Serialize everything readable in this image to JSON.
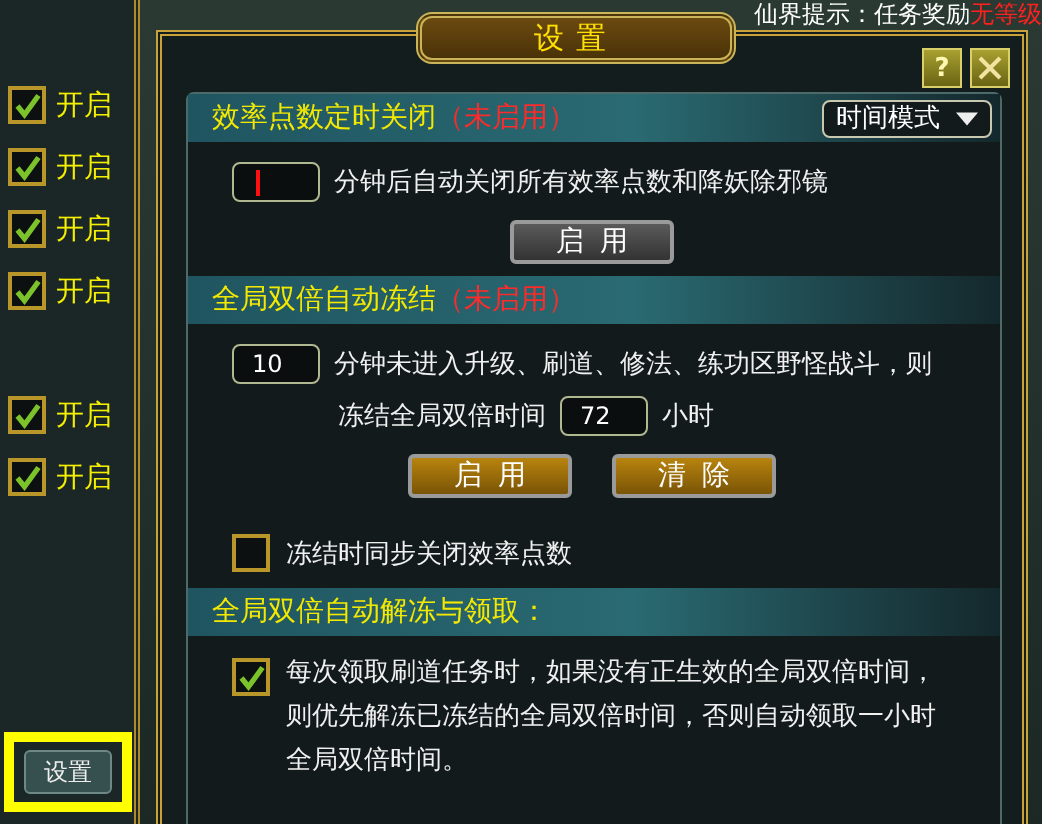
{
  "background": {
    "notice": {
      "label": "仙界提示：任务奖励",
      "highlight": "无等级"
    }
  },
  "sidebar": {
    "toggles": [
      {
        "label": "开启",
        "checked": true
      },
      {
        "label": "开启",
        "checked": true
      },
      {
        "label": "开启",
        "checked": true
      },
      {
        "label": "开启",
        "checked": true
      },
      {
        "label": "开启",
        "checked": true
      },
      {
        "label": "开启",
        "checked": true
      }
    ],
    "settings_button": "设置"
  },
  "dialog": {
    "title": "设置",
    "help": "?",
    "sections": [
      {
        "kind": "timer",
        "title": "效率点数定时关闭",
        "status": "（未启用）",
        "mode_dropdown": "时间模式",
        "minutes": {
          "focused": true
        },
        "description": "分钟后自动关闭所有效率点数和降妖除邪镜",
        "buttons": [
          {
            "label": "启用",
            "disabled": true
          }
        ]
      },
      {
        "kind": "freeze",
        "title": "全局双倍自动冻结",
        "status": "（未启用）",
        "minutes": {
          "value": "10",
          "focused": false
        },
        "text_before": "分钟未进入升级、刷道、修法、练功区野怪战斗，则",
        "text_hours": "冻结全局双倍时间",
        "hours": "72",
        "unit": "小时",
        "buttons": [
          {
            "label": "启用",
            "disabled": false
          },
          {
            "label": "清除",
            "disabled": false
          }
        ],
        "checkbox": {
          "label": "冻结时同步关闭效率点数",
          "checked": false
        }
      },
      {
        "kind": "unfreeze",
        "title": "全局双倍自动解冻与领取：",
        "checkbox": {
          "label": "每次领取刷道任务时，如果没有正生效的全局双倍时间，则优先解冻已冻结的全局双倍时间，否则自动领取一小时全局双倍时间。",
          "checked": true
        }
      }
    ]
  }
}
